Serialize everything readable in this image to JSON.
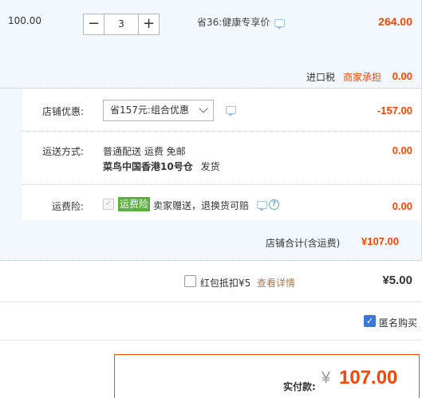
{
  "item": {
    "unit_price": "100.00",
    "quantity": "3",
    "minus_label": "−",
    "plus_label": "+",
    "promo": "省36:健康专享价",
    "total": "264.00",
    "import_tax_label": "进口税",
    "import_tax_tag": "商家承担",
    "import_tax_value": "0.00"
  },
  "shop": {
    "discount_label": "店铺优惠:",
    "discount_select": "省157元:组合优惠",
    "discount_value": "-157.00",
    "shipping_label": "运送方式:",
    "shipping_method": "普通配送 运费 免邮",
    "shipping_origin": "菜鸟中国香港10号仓",
    "shipping_origin_suffix": "发货",
    "shipping_value": "0.00",
    "insurance_label": "运费险:",
    "insurance_tag": "运费险",
    "insurance_desc": "卖家赠送，退换货可赔",
    "insurance_value": "0.00",
    "total_label": "店铺合计(含运费)",
    "total_value": "¥107.00"
  },
  "red_packet": {
    "label": "红包抵扣¥5",
    "details_link": "查看详情",
    "value": "¥5.00"
  },
  "anonymous": {
    "label": "匿名购买"
  },
  "payment": {
    "label": "实付款:",
    "currency": "¥",
    "amount": "107.00"
  },
  "colors": {
    "accent_red": "#ff4400",
    "checkbox_blue": "#3a78d8",
    "insurance_green": "#5cae3f",
    "section_bg": "#f3f8fe"
  }
}
